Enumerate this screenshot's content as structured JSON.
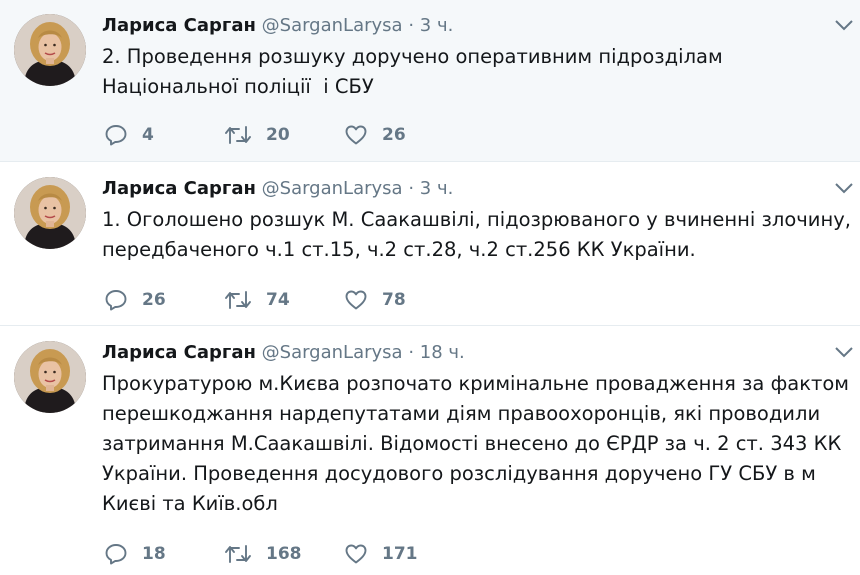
{
  "tweets": [
    {
      "name": "Лариса Сарган",
      "handle": "@SarganLarysa",
      "sep": "·",
      "time": "3 ч.",
      "text": "2. Проведення розшуку доручено оперативним підрозділам Національної поліції  і СБУ",
      "replies": "4",
      "retweets": "20",
      "likes": "26"
    },
    {
      "name": "Лариса Сарган",
      "handle": "@SarganLarysa",
      "sep": "·",
      "time": "3 ч.",
      "text": "1. Оголошено розшук М. Саакашвілі, підозрюваного у вчиненні злочину, передбаченого ч.1 ст.15, ч.2 ст.28, ч.2 ст.256 КК України.",
      "replies": "26",
      "retweets": "74",
      "likes": "78"
    },
    {
      "name": "Лариса Сарган",
      "handle": "@SarganLarysa",
      "sep": "·",
      "time": "18 ч.",
      "text": "Прокуратурою м.Києва розпочато кримінальне провадження за фактом перешкоджання нардепутатами діям правоохоронців, які проводили затримання М.Саакашвілі. Відомості внесено до ЄРДР за ч. 2 ст. 343 КК України. Проведення досудового розслідування доручено ГУ СБУ в м Києві та Київ.обл",
      "replies": "18",
      "retweets": "168",
      "likes": "171"
    }
  ],
  "icons": {
    "reply": "reply-icon",
    "retweet": "retweet-icon",
    "like": "heart-icon",
    "more": "chevron-down-icon"
  },
  "colors": {
    "name": "#14171a",
    "muted": "#657786",
    "highlight_bg": "#f5f8fa",
    "divider": "#e6ecf0"
  }
}
